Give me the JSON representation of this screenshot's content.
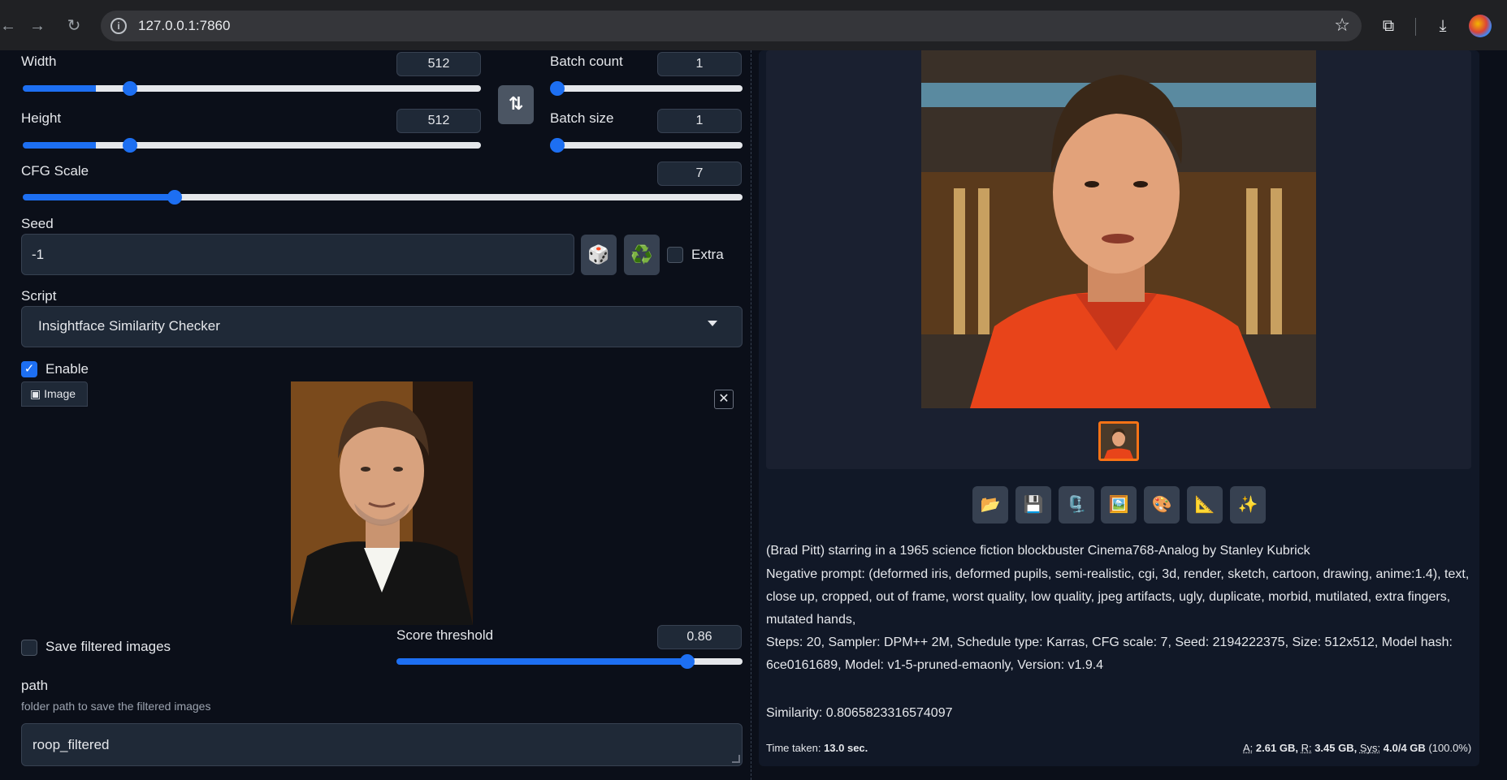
{
  "browser": {
    "url": "127.0.0.1:7860"
  },
  "left": {
    "width": {
      "label": "Width",
      "value": "512",
      "fraction": 0.16
    },
    "height": {
      "label": "Height",
      "value": "512",
      "fraction": 0.16
    },
    "batch_count": {
      "label": "Batch count",
      "value": "1",
      "fraction": 0.0
    },
    "batch_size": {
      "label": "Batch size",
      "value": "1",
      "fraction": 0.0
    },
    "cfg_scale": {
      "label": "CFG Scale",
      "value": "7",
      "fraction": 0.21
    },
    "seed": {
      "label": "Seed",
      "value": "-1",
      "extra_label": "Extra"
    },
    "script": {
      "label": "Script",
      "selected": "Insightface Similarity Checker"
    },
    "enable_label": "Enable",
    "image_tab": "Image",
    "save_filtered_label": "Save filtered images",
    "score_threshold": {
      "label": "Score threshold",
      "value": "0.86",
      "fraction": 0.86
    },
    "path": {
      "label": "path",
      "description": "folder path to save the filtered images",
      "value": "roop_filtered"
    }
  },
  "right": {
    "prompt": "(Brad Pitt) starring in a 1965 science fiction blockbuster Cinema768-Analog by Stanley Kubrick",
    "negative_prompt": "Negative prompt: (deformed iris, deformed pupils, semi-realistic, cgi, 3d, render, sketch, cartoon, drawing, anime:1.4), text, close up, cropped, out of frame, worst quality, low quality, jpeg artifacts, ugly, duplicate, morbid, mutilated, extra fingers, mutated hands,",
    "params": "Steps: 20, Sampler: DPM++ 2M, Schedule type: Karras, CFG scale: 7, Seed: 2194222375, Size: 512x512, Model hash: 6ce0161689, Model: v1-5-pruned-emaonly, Version: v1.9.4",
    "similarity": "Similarity: 0.8065823316574097",
    "time_taken_label": "Time taken:",
    "time_taken_value": "13.0 sec.",
    "mem_a_label": "A:",
    "mem_a_value": "2.61 GB,",
    "mem_r_label": "R:",
    "mem_r_value": "3.45 GB,",
    "mem_sys_label": "Sys:",
    "mem_sys_value": "4.0/4 GB",
    "mem_pct": "(100.0%)",
    "tools": [
      "📂",
      "💾",
      "🗜️",
      "🖼️",
      "🎨",
      "📐",
      "✨"
    ]
  },
  "colors": {
    "accent": "#1d6ff2",
    "bg": "#0b0f19",
    "panel": "#111827"
  }
}
